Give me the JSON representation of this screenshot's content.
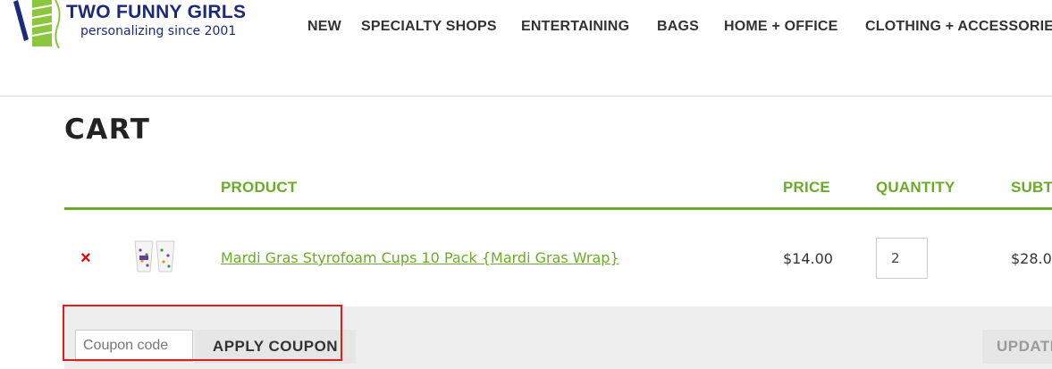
{
  "header": {
    "logo_title": "TWO FUNNY GIRLS",
    "logo_tagline": "personalizing since 2001",
    "nav": [
      {
        "label": "NEW"
      },
      {
        "label": "SPECIALTY SHOPS"
      },
      {
        "label": "ENTERTAINING"
      },
      {
        "label": "BAGS"
      },
      {
        "label": "HOME + OFFICE"
      },
      {
        "label": "CLOTHING + ACCESSORIES"
      }
    ]
  },
  "cart": {
    "title": "CART",
    "columns": {
      "product": "PRODUCT",
      "price": "PRICE",
      "quantity": "QUANTITY",
      "subtotal": "SUBTOTAL"
    },
    "items": [
      {
        "remove_symbol": "×",
        "thumbnail_icon": "styrofoam-cups-icon",
        "name": "Mardi Gras Styrofoam Cups 10 Pack {Mardi Gras Wrap}",
        "price": "$14.00",
        "quantity": "2",
        "subtotal": "$28.00"
      }
    ],
    "actions": {
      "coupon_placeholder": "Coupon code",
      "coupon_value": "",
      "apply_label": "APPLY COUPON",
      "update_label": "UPDATE CART"
    }
  },
  "colors": {
    "accent_green": "#6bab2a",
    "brand_navy": "#1b2a7a",
    "remove_red": "#e00000",
    "highlight_red": "#e31b1b"
  }
}
